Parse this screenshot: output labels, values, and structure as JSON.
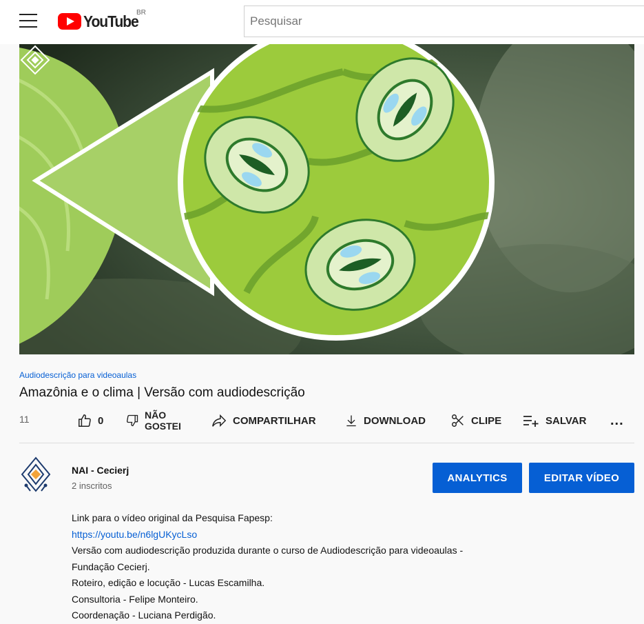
{
  "header": {
    "logo_text": "YouTube",
    "country": "BR",
    "search_placeholder": "Pesquisar"
  },
  "video": {
    "channel_tag": "Audiodescrição para videoaulas",
    "title": "Amazônia e o clima | Versão com audiodescrição",
    "views": "11"
  },
  "actions": {
    "like_count": "0",
    "dislike_label_1": "NÃO",
    "dislike_label_2": "GOSTEI",
    "share": "COMPARTILHAR",
    "download": "DOWNLOAD",
    "clip": "CLIPE",
    "save": "SALVAR",
    "more": "..."
  },
  "channel": {
    "name": "NAI - Cecierj",
    "subscribers": "2 inscritos",
    "analytics_button": "ANALYTICS",
    "edit_button": "EDITAR VÍDEO"
  },
  "description": {
    "line1": "Link para o vídeo original da Pesquisa Fapesp:",
    "link": "https://youtu.be/n6lgUKycLso",
    "line3": "Versão com audiodescrição produzida durante o curso de Audiodescrição para videoaulas -",
    "line4": "Fundação Cecierj.",
    "line5": "Roteiro, edição e locução - Lucas Escamilha.",
    "line6": "Consultoria - Felipe Monteiro.",
    "line7": "Coordenação - Luciana Perdigão."
  },
  "colors": {
    "accent_blue": "#065fd4",
    "youtube_red": "#ff0000",
    "leaf_green": "#9ccb3c"
  },
  "icons": [
    "menu-icon",
    "youtube-logo-icon",
    "thumbs-up-icon",
    "thumbs-down-icon",
    "share-icon",
    "download-icon",
    "scissors-icon",
    "playlist-add-icon",
    "more-icon",
    "channel-logo-icon"
  ]
}
